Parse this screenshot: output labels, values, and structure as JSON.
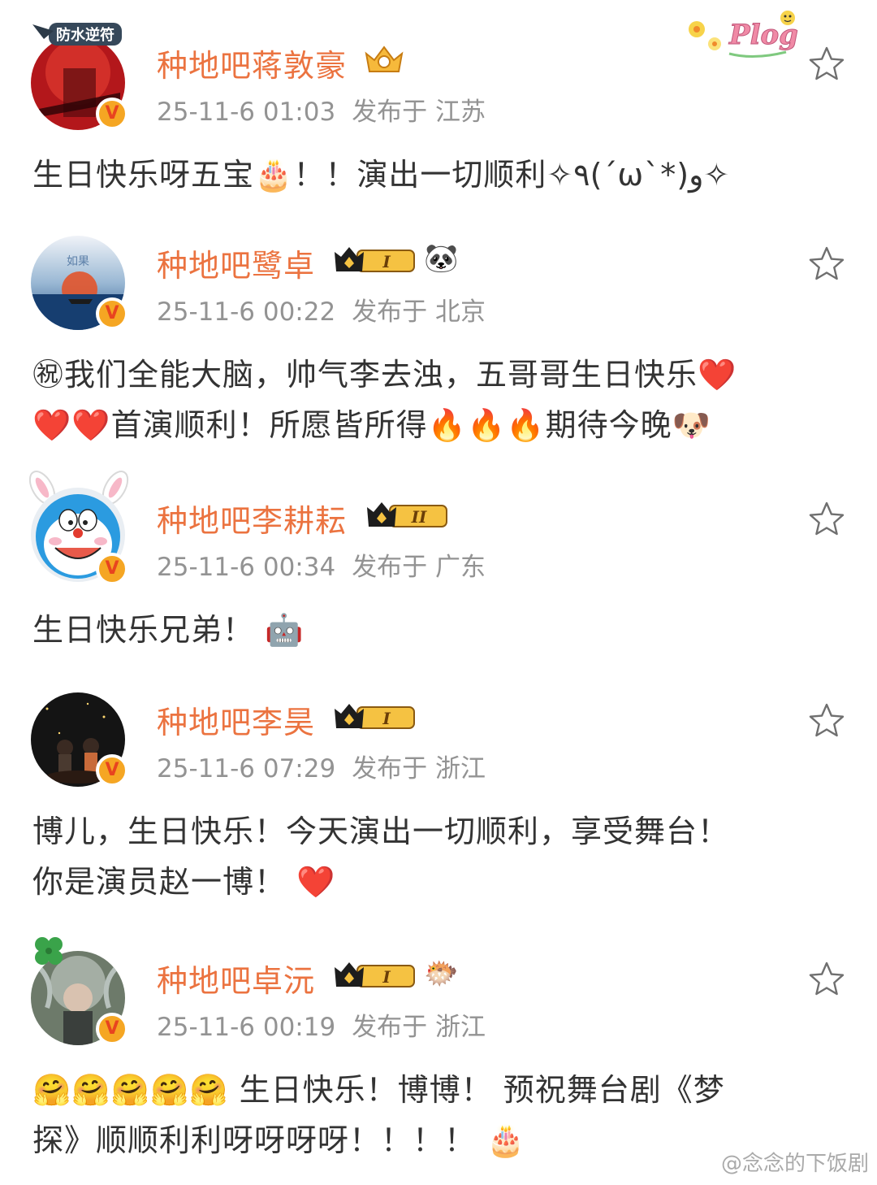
{
  "posts": [
    {
      "username": "种地吧蒋敦豪",
      "date": "25-11-6 01:03",
      "location": "发布于 江苏",
      "frame_label": "防水逆符",
      "badge_level": "",
      "extra_emoji": "",
      "lines": [
        "生日快乐呀五宝🎂！！演出一切顺利✧٩(ˊωˋ*)و✧"
      ]
    },
    {
      "username": "种地吧鹭卓",
      "date": "25-11-6 00:22",
      "location": "发布于 北京",
      "badge_level": "I",
      "extra_emoji": "🐼",
      "lines": [
        "㊗我们全能大脑，帅气李去浊，五哥哥生日快乐❤️",
        "❤️❤️首演顺利！所愿皆所得🔥🔥🔥期待今晚🐶"
      ]
    },
    {
      "username": "种地吧李耕耘",
      "date": "25-11-6 00:34",
      "location": "发布于 广东",
      "badge_level": "II",
      "extra_emoji": "",
      "lines": [
        "生日快乐兄弟！ 🤖"
      ]
    },
    {
      "username": "种地吧李昊",
      "date": "25-11-6 07:29",
      "location": "发布于 浙江",
      "badge_level": "I",
      "extra_emoji": "",
      "lines": [
        "博儿，生日快乐！今天演出一切顺利，享受舞台！",
        "你是演员赵一博！ ❤️"
      ]
    },
    {
      "username": "种地吧卓沅",
      "date": "25-11-6 00:19",
      "location": "发布于 浙江",
      "badge_level": "I",
      "extra_emoji": "🐡",
      "lines": [
        "🤗🤗🤗🤗🤗 生日快乐！博博！ 预祝舞台剧《梦",
        "探》顺顺利利呀呀呀呀！！！！ 🎂"
      ]
    }
  ],
  "plog_sticker": "Plog",
  "watermark": "@念念的下饭剧",
  "colors": {
    "username": "#eb7340",
    "meta": "#939393",
    "text": "#333333",
    "verified_bg": "#f5a623"
  },
  "icons": {
    "favorite": "star-outline-icon",
    "verified": "verified-v-icon",
    "member": "crown-badge-icon"
  }
}
